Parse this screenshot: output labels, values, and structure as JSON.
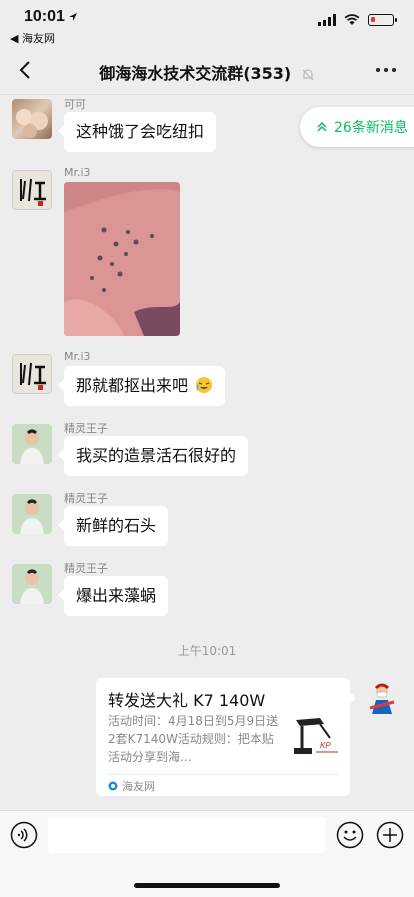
{
  "status_bar": {
    "time": "10:01",
    "back_app": "◀ 海友网"
  },
  "header": {
    "title": "御海海水技术交流群(353)"
  },
  "new_messages": {
    "label": "26条新消息"
  },
  "messages": [
    {
      "sender": "可可",
      "text": "这种饿了会吃纽扣"
    },
    {
      "sender": "Mr.i3",
      "text": ""
    },
    {
      "sender": "Mr.i3",
      "text": "那就都抠出来吧"
    },
    {
      "sender": "精灵王子",
      "text": "我买的造景活石很好的"
    },
    {
      "sender": "精灵王子",
      "text": "新鲜的石头"
    },
    {
      "sender": "精灵王子",
      "text": "爆出来藻蜗"
    }
  ],
  "timestamp": "上午10:01",
  "shared_card": {
    "title": "转发送大礼 K7 140W",
    "description": "活动时间：4月18日到5月9日送2套K7140W活动规则：把本贴活动分享到海...",
    "source": "海友网"
  },
  "colors": {
    "accent": "#07c160",
    "background": "#ededed"
  }
}
